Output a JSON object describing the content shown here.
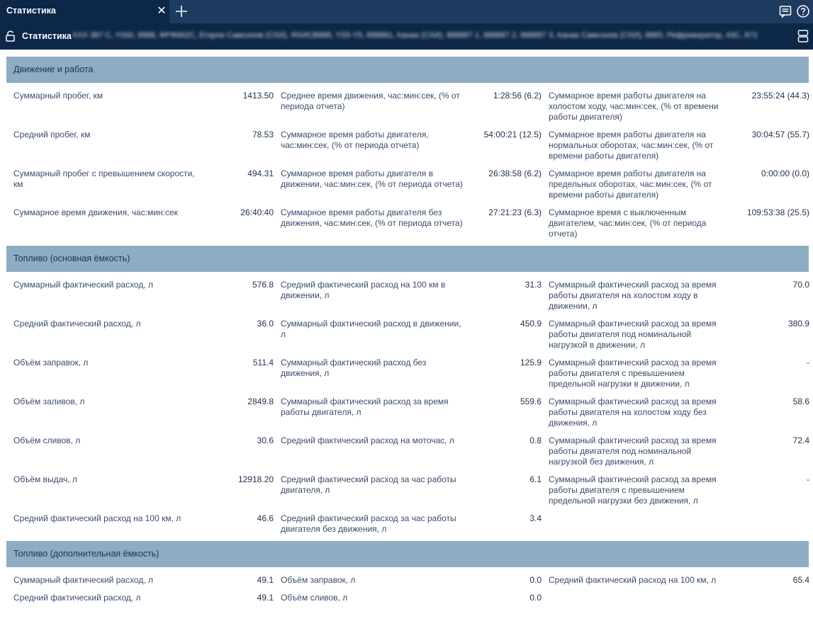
{
  "tab": {
    "title": "Статистика",
    "close_glyph": "✕"
  },
  "toolbar": {
    "add_tab_icon": "plus-icon",
    "notes_icon": "notes-icon",
    "help_icon": "help-icon"
  },
  "header": {
    "title": "Статистика",
    "blurred_details": "XXX 387 С, Y000, 8888, ФРФ662С, Егорла Самсонов (СХИ), ЯХИСВ888, YS5-Y5, 888881, Канаа (СХИ), 888887 1, 888887 2, 888887 3, Канаа Самсонов (СХИ), 8865, Рефрижератор, 43С, 872"
  },
  "sections": [
    {
      "title": "Движение и работа",
      "rows": [
        [
          {
            "label": "Суммарный пробег, км",
            "value": "1413.50"
          },
          {
            "label": "Среднее время движения, час:мин:сек, (% от периода отчета)",
            "value": "1:28:56 (6.2)"
          },
          {
            "label": "Суммарное время работы двигателя на холостом ходу, час:мин:сек, (% от времени работы двигателя)",
            "value": "23:55:24 (44.3)"
          }
        ],
        [
          {
            "label": "Средний пробег, км",
            "value": "78.53"
          },
          {
            "label": "Суммарное время работы двигателя, час:мин:сек, (% от периода отчета)",
            "value": "54:00:21 (12.5)"
          },
          {
            "label": "Суммарное время работы двигателя на нормальных оборотах, час:мин:сек, (% от времени работы двигателя)",
            "value": "30:04:57 (55.7)"
          }
        ],
        [
          {
            "label": "Суммарный пробег с превышением скорости, км",
            "value": "494.31"
          },
          {
            "label": "Суммарное время работы двигателя в движении, час:мин:сек, (% от периода отчета)",
            "value": "26:38:58 (6.2)"
          },
          {
            "label": "Суммарное время работы двигателя на предельных оборотах, час:мин:сек, (% от времени работы двигателя)",
            "value": "0:00:00 (0.0)"
          }
        ],
        [
          {
            "label": "Суммарное время движения, час:мин:сек",
            "value": "26:40:40"
          },
          {
            "label": "Суммарное время работы двигателя без движения, час:мин:сек, (% от периода отчета)",
            "value": "27:21:23 (6.3)"
          },
          {
            "label": "Суммарное время с выключенным двигателем, час:мин:сек, (% от периода отчета)",
            "value": "109:53:38 (25.5)"
          }
        ]
      ]
    },
    {
      "title": "Топливо (основная ёмкость)",
      "rows": [
        [
          {
            "label": "Суммарный фактический расход, л",
            "value": "576.8"
          },
          {
            "label": "Средний фактический расход на 100 км в движении, л",
            "value": "31.3"
          },
          {
            "label": "Суммарный фактический расход за время работы двигателя на холостом ходу в движении, л",
            "value": "70.0"
          }
        ],
        [
          {
            "label": "Средний фактический расход, л",
            "value": "36.0"
          },
          {
            "label": "Суммарный фактический расход в движении, л",
            "value": "450.9"
          },
          {
            "label": "Суммарный фактический расход за время работы двигателя под номинальной нагрузкой в движении, л",
            "value": "380.9"
          }
        ],
        [
          {
            "label": "Объём заправок, л",
            "value": "511.4"
          },
          {
            "label": "Суммарный фактический расход без движения, л",
            "value": "125.9"
          },
          {
            "label": "Суммарный фактический расход за время работы двигателя с превышением предельной нагрузки в движении, л",
            "value": "-"
          }
        ],
        [
          {
            "label": "Объём заливов, л",
            "value": "2849.8"
          },
          {
            "label": "Суммарный фактический расход за время работы двигателя, л",
            "value": "559.6"
          },
          {
            "label": "Суммарный фактический расход за время работы двигателя на холостом ходу без движения, л",
            "value": "58.6"
          }
        ],
        [
          {
            "label": "Объём сливов, л",
            "value": "30.6"
          },
          {
            "label": "Средний фактический расход на моточас, л",
            "value": "0.8"
          },
          {
            "label": "Суммарный фактический расход за время работы двигателя под номинальной нагрузкой без движения, л",
            "value": "72.4"
          }
        ],
        [
          {
            "label": "Объём выдач, л",
            "value": "12918.20"
          },
          {
            "label": "Средний фактический расход за час работы двигателя, л",
            "value": "6.1"
          },
          {
            "label": "Суммарный фактический расход за время работы двигателя с превышением предельной нагрузки без движения, л",
            "value": "-"
          }
        ],
        [
          {
            "label": "Средний фактический расход на 100 км, л",
            "value": "46.6"
          },
          {
            "label": "Средний фактический расход за час работы двигателя без движения, л",
            "value": "3.4"
          },
          {
            "label": "",
            "value": ""
          }
        ]
      ]
    },
    {
      "title": "Топливо (дополнительная ёмкость)",
      "rows": [
        [
          {
            "label": "Суммарный фактический расход, л",
            "value": "49.1"
          },
          {
            "label": "Объём заправок, л",
            "value": "0.0"
          },
          {
            "label": "Средний фактический расход на 100 км, л",
            "value": "65.4"
          }
        ],
        [
          {
            "label": "Средний фактический расход, л",
            "value": "49.1"
          },
          {
            "label": "Объём сливов, л",
            "value": "0.0"
          },
          {
            "label": "",
            "value": ""
          }
        ]
      ]
    }
  ]
}
